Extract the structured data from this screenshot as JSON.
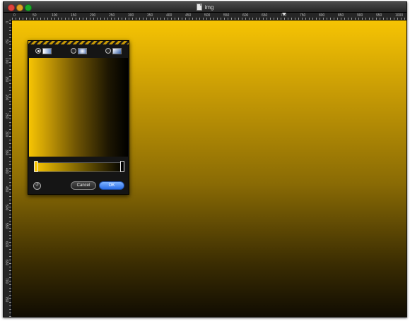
{
  "window": {
    "title": "img"
  },
  "ruler": {
    "top_labels": [
      "0",
      "50",
      "100",
      "150",
      "200",
      "250",
      "300",
      "350",
      "400",
      "450",
      "500",
      "550",
      "600",
      "650",
      "700",
      "750",
      "800",
      "850",
      "900",
      "950",
      "1000"
    ],
    "left_labels": [
      "0",
      "50",
      "100",
      "150",
      "200",
      "250",
      "300",
      "350",
      "400",
      "450",
      "500",
      "550",
      "600",
      "650",
      "700",
      "750"
    ]
  },
  "gradient_panel": {
    "modes": [
      {
        "name": "linear",
        "selected": true
      },
      {
        "name": "radial",
        "selected": false
      },
      {
        "name": "angular",
        "selected": false
      }
    ],
    "colors": {
      "start": "#f6c403",
      "end": "#000000"
    },
    "buttons": {
      "cancel_label": "Cancel",
      "ok_label": "OK"
    }
  }
}
